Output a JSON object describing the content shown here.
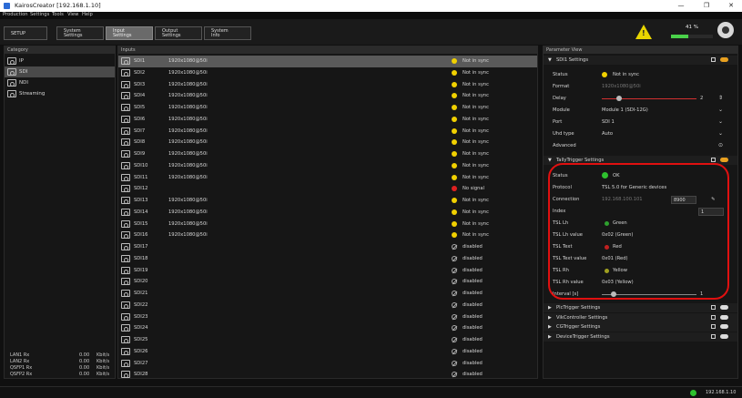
{
  "window": {
    "title": "KairosCreator [192.168.1.10]",
    "min": "—",
    "max": "❐",
    "close": "✕"
  },
  "menu": [
    "Production",
    "Settings",
    "Tools",
    "View",
    "Help"
  ],
  "toolbar": {
    "setup": "SETUP",
    "tabs": [
      {
        "l1": "System",
        "l2": "Settings"
      },
      {
        "l1": "Input",
        "l2": "Settings"
      },
      {
        "l1": "Output",
        "l2": "Settings"
      },
      {
        "l1": "System",
        "l2": "Info"
      }
    ],
    "percent": "41 %",
    "progress": 0.41,
    "warn": "!"
  },
  "category": {
    "header": "Category",
    "items": [
      "IP",
      "SDI",
      "NDI",
      "Streaming"
    ]
  },
  "network": [
    {
      "n": "LAN1 Rx",
      "v": "0.00",
      "u": "Kbit/s"
    },
    {
      "n": "LAN2 Rx",
      "v": "0.00",
      "u": "Kbit/s"
    },
    {
      "n": "QSFP1 Rx",
      "v": "0.00",
      "u": "Kbit/s"
    },
    {
      "n": "QSFP2 Rx",
      "v": "0.00",
      "u": "Kbit/s"
    }
  ],
  "inputs": {
    "header": "Inputs",
    "rows": [
      {
        "n": "SDI1",
        "f": "1920x1080@50i",
        "s": "Not in sync",
        "c": "y"
      },
      {
        "n": "SDI2",
        "f": "1920x1080@50i",
        "s": "Not in sync",
        "c": "y"
      },
      {
        "n": "SDI3",
        "f": "1920x1080@50i",
        "s": "Not in sync",
        "c": "y"
      },
      {
        "n": "SDI4",
        "f": "1920x1080@50i",
        "s": "Not in sync",
        "c": "y"
      },
      {
        "n": "SDI5",
        "f": "1920x1080@50i",
        "s": "Not in sync",
        "c": "y"
      },
      {
        "n": "SDI6",
        "f": "1920x1080@50i",
        "s": "Not in sync",
        "c": "y"
      },
      {
        "n": "SDI7",
        "f": "1920x1080@50i",
        "s": "Not in sync",
        "c": "y"
      },
      {
        "n": "SDI8",
        "f": "1920x1080@50i",
        "s": "Not in sync",
        "c": "y"
      },
      {
        "n": "SDI9",
        "f": "1920x1080@50i",
        "s": "Not in sync",
        "c": "y"
      },
      {
        "n": "SDI10",
        "f": "1920x1080@50i",
        "s": "Not in sync",
        "c": "y"
      },
      {
        "n": "SDI11",
        "f": "1920x1080@50i",
        "s": "Not in sync",
        "c": "y"
      },
      {
        "n": "SDI12",
        "f": "",
        "s": "No signal",
        "c": "r"
      },
      {
        "n": "SDI13",
        "f": "1920x1080@50i",
        "s": "Not in sync",
        "c": "y"
      },
      {
        "n": "SDI14",
        "f": "1920x1080@50i",
        "s": "Not in sync",
        "c": "y"
      },
      {
        "n": "SDI15",
        "f": "1920x1080@50i",
        "s": "Not in sync",
        "c": "y"
      },
      {
        "n": "SDI16",
        "f": "1920x1080@50i",
        "s": "Not in sync",
        "c": "y"
      },
      {
        "n": "SDI17",
        "f": "",
        "s": "disabled",
        "c": "d"
      },
      {
        "n": "SDI18",
        "f": "",
        "s": "disabled",
        "c": "d"
      },
      {
        "n": "SDI19",
        "f": "",
        "s": "disabled",
        "c": "d"
      },
      {
        "n": "SDI20",
        "f": "",
        "s": "disabled",
        "c": "d"
      },
      {
        "n": "SDI21",
        "f": "",
        "s": "disabled",
        "c": "d"
      },
      {
        "n": "SDI22",
        "f": "",
        "s": "disabled",
        "c": "d"
      },
      {
        "n": "SDI23",
        "f": "",
        "s": "disabled",
        "c": "d"
      },
      {
        "n": "SDI24",
        "f": "",
        "s": "disabled",
        "c": "d"
      },
      {
        "n": "SDI25",
        "f": "",
        "s": "disabled",
        "c": "d"
      },
      {
        "n": "SDI26",
        "f": "",
        "s": "disabled",
        "c": "d"
      },
      {
        "n": "SDI27",
        "f": "",
        "s": "disabled",
        "c": "d"
      },
      {
        "n": "SDI28",
        "f": "",
        "s": "disabled",
        "c": "d"
      }
    ]
  },
  "params": {
    "header": "Parameter View",
    "sdi": {
      "title": "SDI1 Settings",
      "status_k": "Status",
      "status_v": "Not in sync",
      "format_k": "Format",
      "format_v": "1920x1080@50i",
      "delay_k": "Delay",
      "delay_v": "2",
      "module_k": "Module",
      "module_v": "Module 1 (SDI-12G)",
      "port_k": "Port",
      "port_v": "SDI 1",
      "uhd_k": "Uhd type",
      "uhd_v": "Auto",
      "adv_k": "Advanced"
    },
    "tally": {
      "title": "TallyTrigger Settings",
      "status_k": "Status",
      "status_v": "OK",
      "protocol_k": "Protocol",
      "protocol_v": "TSL 5.0 for Generic devices",
      "conn_k": "Connection",
      "conn_ip": "192.168.100.101",
      "conn_port": "8900",
      "index_k": "Index",
      "index_v": "1",
      "rows": [
        {
          "k": "TSL Lh",
          "v": "Green",
          "c": "#2ea02e"
        },
        {
          "k": "TSL Lh value",
          "v": "0x02 (Green)"
        },
        {
          "k": "TSL Text",
          "v": "Red",
          "c": "#c02020"
        },
        {
          "k": "TSL Text value",
          "v": "0x01 (Red)"
        },
        {
          "k": "TSL Rh",
          "v": "Yellow",
          "c": "#a0a020"
        },
        {
          "k": "TSL Rh value",
          "v": "0x03 (Yellow)"
        }
      ],
      "interval_k": "Interval [s]",
      "interval_v": "1"
    },
    "others": [
      "PlcTrigger Settings",
      "VikController Settings",
      "CGTrigger Settings",
      "DeviceTrigger Settings"
    ]
  },
  "status": {
    "ip": "192.168.1.10"
  }
}
